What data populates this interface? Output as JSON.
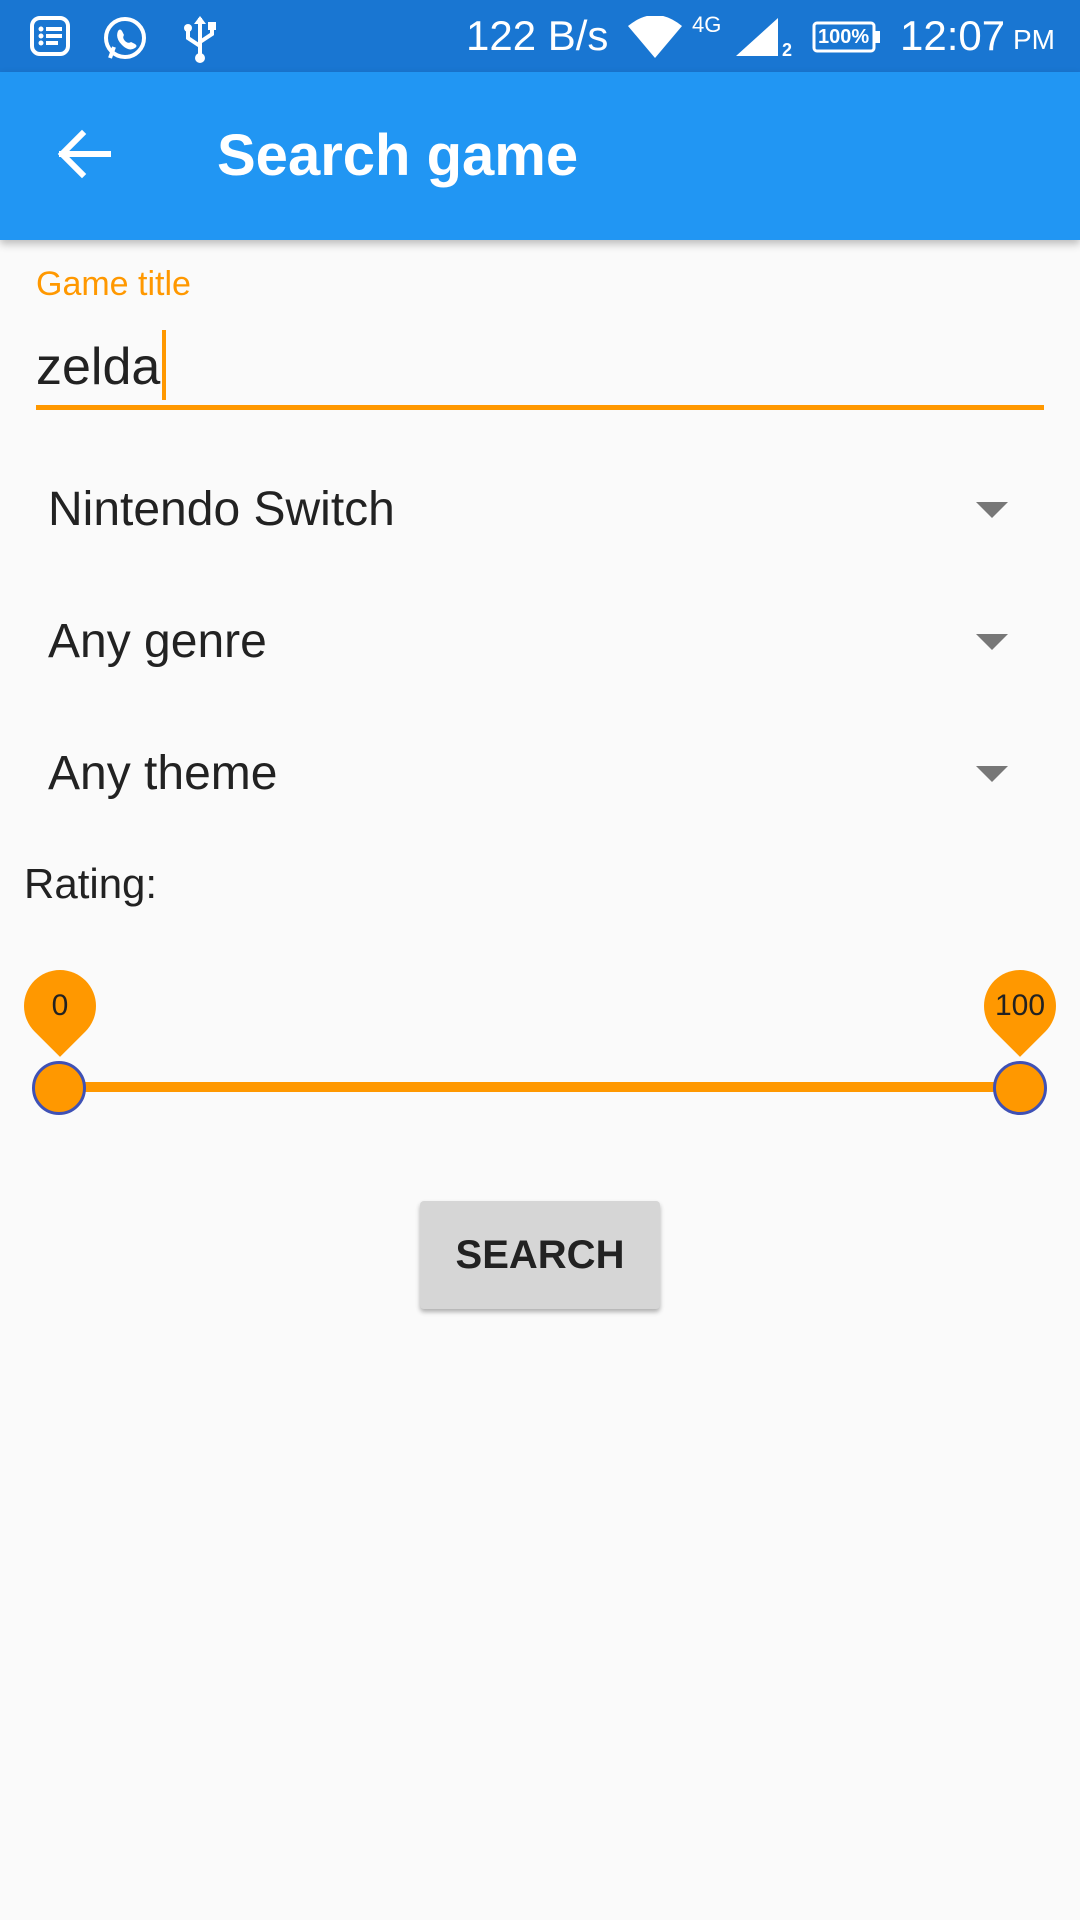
{
  "status_bar": {
    "net_speed": "122 B/s",
    "network_type": "4G",
    "sim_slot": "2",
    "battery": "100%",
    "time": "12:07",
    "ampm": "PM",
    "icons": [
      "notes-icon",
      "whatsapp-icon",
      "usb-icon",
      "wifi-icon",
      "signal-icon",
      "battery-icon"
    ]
  },
  "app_bar": {
    "title": "Search game",
    "back_icon": "arrow-back-icon"
  },
  "form": {
    "title_field": {
      "label": "Game title",
      "value": "zelda"
    },
    "platform": {
      "selected": "Nintendo Switch"
    },
    "genre": {
      "selected": "Any genre"
    },
    "theme": {
      "selected": "Any theme"
    },
    "rating": {
      "label": "Rating:",
      "min_value": "0",
      "max_value": "100",
      "range_min": 0,
      "range_max": 100
    },
    "search_label": "SEARCH"
  },
  "colors": {
    "status_bar": "#1976d2",
    "app_bar": "#2196f3",
    "accent": "#ff9800",
    "thumb_border": "#3f51b5",
    "background": "#fafafa",
    "button": "#d6d6d6"
  }
}
